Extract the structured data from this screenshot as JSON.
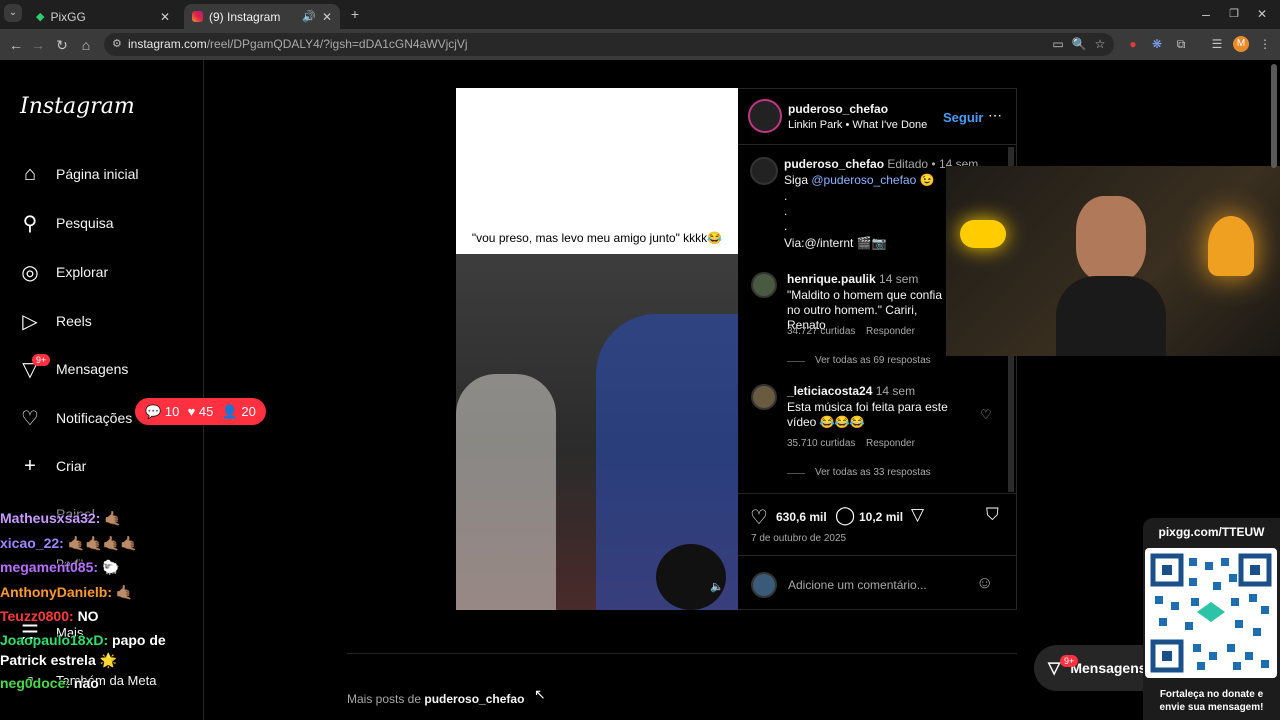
{
  "browser": {
    "tabs": [
      {
        "label": "PixGG",
        "active": false
      },
      {
        "label": "(9) Instagram",
        "active": true
      }
    ],
    "url_host": "instagram.com",
    "url_path": "/reel/DPgamQDALY4/?igsh=dDA1cGN4aWVjcjVj",
    "profile_initial": "M"
  },
  "sidebar": {
    "logo": "Instagram",
    "items": [
      {
        "label": "Página inicial",
        "icon": "home-icon"
      },
      {
        "label": "Pesquisa",
        "icon": "search-icon"
      },
      {
        "label": "Explorar",
        "icon": "compass-icon"
      },
      {
        "label": "Reels",
        "icon": "reels-icon"
      },
      {
        "label": "Mensagens",
        "icon": "messenger-icon",
        "badge": "9+"
      },
      {
        "label": "Notificações",
        "icon": "heart-icon"
      },
      {
        "label": "Criar",
        "icon": "plus-icon"
      },
      {
        "label": "Painel",
        "icon": "dashboard-icon"
      },
      {
        "label": "Perfil",
        "icon": "profile-icon"
      },
      {
        "label": "Mais",
        "icon": "menu-icon"
      },
      {
        "label": "Também da Meta",
        "icon": "meta-icon"
      }
    ]
  },
  "notif_pill": {
    "comments": "10",
    "likes": "45",
    "followers": "20"
  },
  "chat": [
    {
      "user": "Matheusxsa32:",
      "msg": "🤙🏽",
      "color": "#c89cff"
    },
    {
      "user": "xicao_22:",
      "msg": "🤙🏽🤙🏽🤙🏽🤙🏽",
      "color": "#9f86ff"
    },
    {
      "user": "megament085:",
      "msg": "🐑",
      "color": "#b870ff"
    },
    {
      "user": "AnthonyDanielb:",
      "msg": "🤙🏽",
      "color": "#ff9a2e"
    },
    {
      "user": "Teuzz0800:",
      "msg": "NO",
      "color": "#ff3b3b"
    },
    {
      "user": "Joaopaulo18xD:",
      "msg": "papo de",
      "color": "#2ee06d"
    },
    {
      "user": "",
      "msg": "Patrick estrela 🌟",
      "color": "#ffffff"
    },
    {
      "user": "neg0doce:",
      "msg": "nao",
      "color": "#4bd84b"
    }
  ],
  "post": {
    "video_caption": "\"vou preso, mas levo meu amigo junto\" kkkk😂",
    "author": "puderoso_chefao",
    "audio": "Linkin Park • What I've Done",
    "follow_label": "Seguir",
    "caption": {
      "user": "puderoso_chefao",
      "edited": "Editado •",
      "time": "14 sem",
      "line1_prefix": "Siga ",
      "mention": "@puderoso_chefao",
      "line1_suffix": " 😉",
      "dots": [
        ".",
        ".",
        "."
      ],
      "via": "Via:@/internt 🎬📷"
    },
    "comments": [
      {
        "user": "henrique.paulik",
        "time": "14 sem",
        "text": "\"Maldito o homem que confia no outro homem.\" Cariri, Renato",
        "likes": "34.727 curtidas",
        "reply": "Responder",
        "view_replies": "Ver todas as 69 respostas"
      },
      {
        "user": "_leticiacosta24",
        "time": "14 sem",
        "text": "Esta música foi feita para este vídeo 😂😂😂",
        "likes": "35.710 curtidas",
        "reply": "Responder",
        "view_replies": "Ver todas as 33 respostas"
      }
    ],
    "likes": "630,6 mil",
    "comment_count": "10,2 mil",
    "date": "7 de outubro de 2025",
    "comment_placeholder": "Adicione um comentário..."
  },
  "more_posts": {
    "prefix": "Mais posts de ",
    "user": "puderoso_chefao"
  },
  "messages_button": {
    "label": "Mensagens",
    "badge": "9+"
  },
  "pixgg": {
    "url": "pixgg.com/TTEUW",
    "cta": "Fortaleça no donate e envie sua mensagem!"
  }
}
